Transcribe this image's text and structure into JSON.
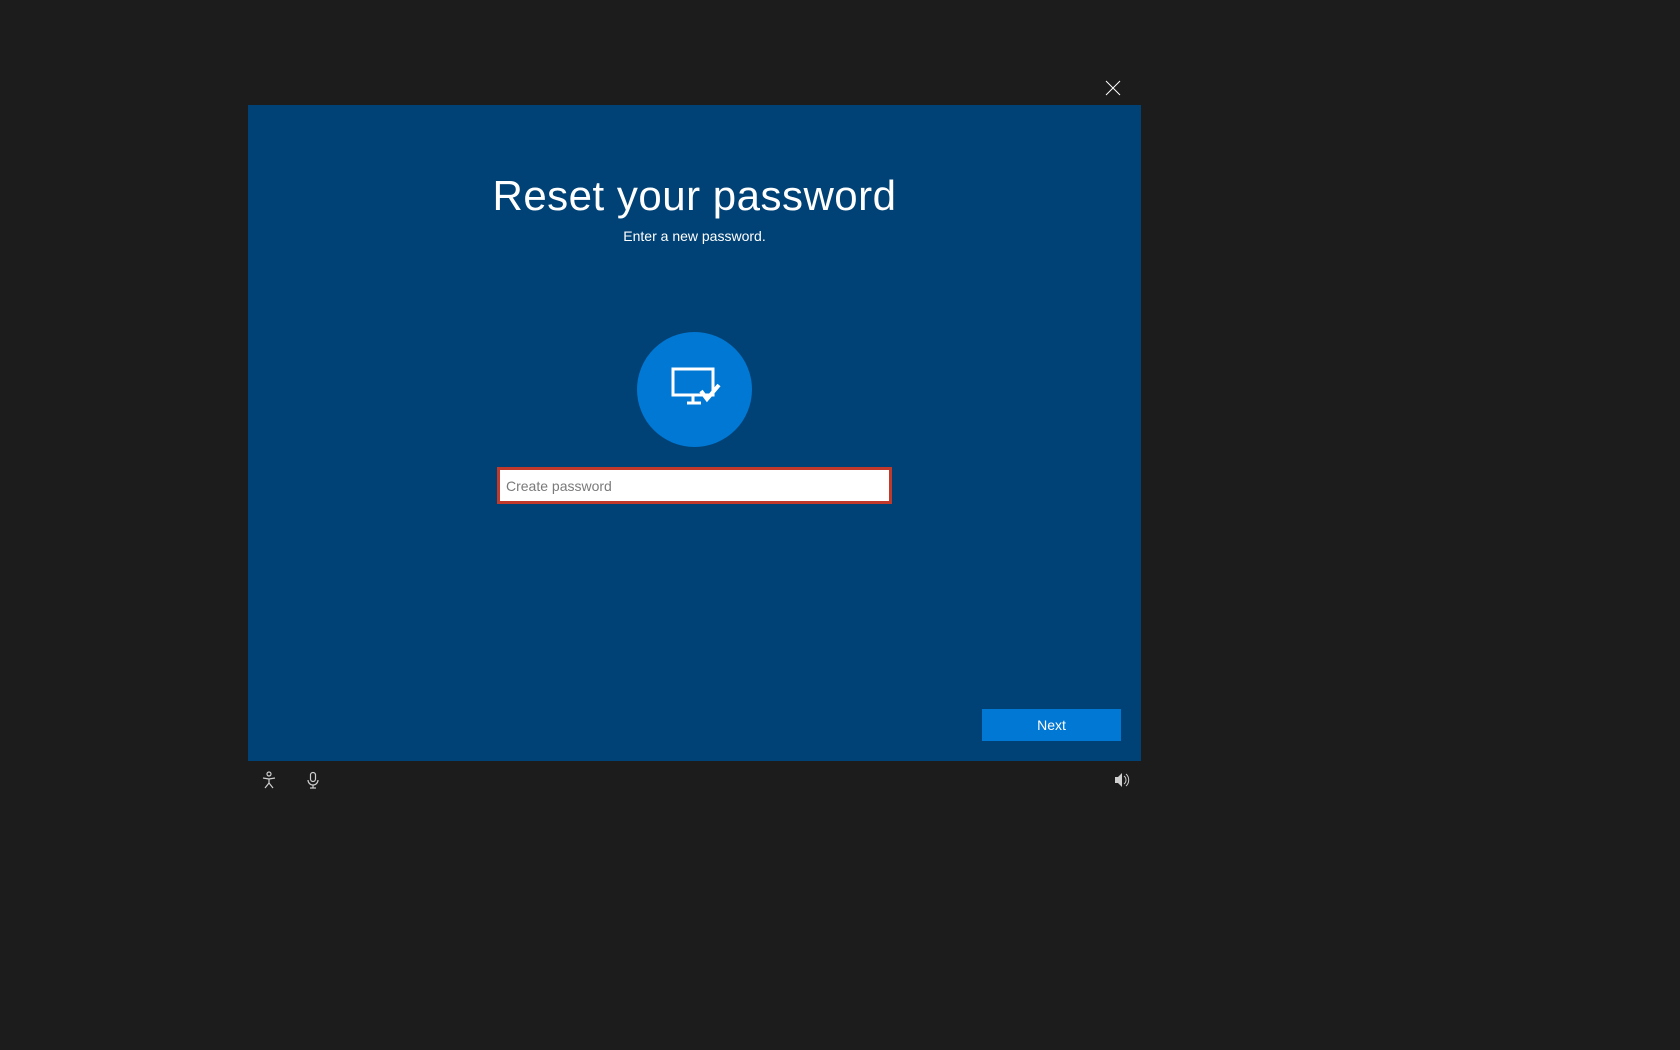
{
  "dialog": {
    "title": "Reset your password",
    "subtitle": "Enter a new password.",
    "password_placeholder": "Create password",
    "password_value": "",
    "next_label": "Next"
  },
  "colors": {
    "panel_bg": "#004275",
    "accent": "#0078d4",
    "highlight_border": "#c0392b",
    "page_bg": "#1c1c1c"
  },
  "icons": {
    "close": "close-icon",
    "avatar": "monitor-check-icon",
    "ease_of_access": "ease-of-access-icon",
    "microphone": "microphone-icon",
    "volume": "volume-icon"
  }
}
